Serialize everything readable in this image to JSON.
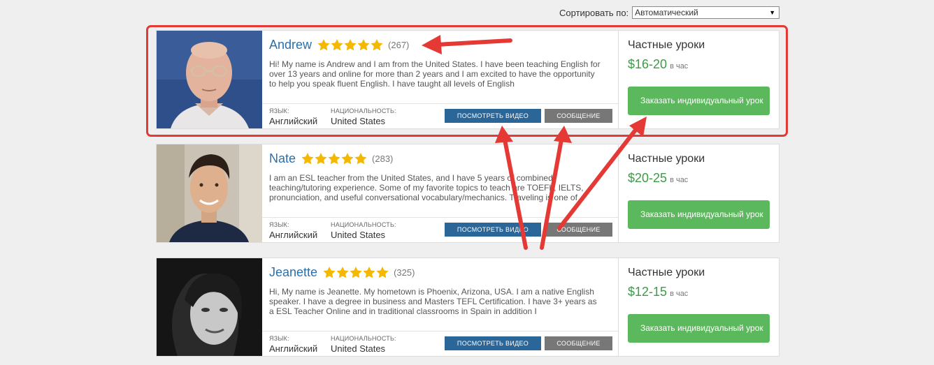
{
  "sort": {
    "label": "Сортировать по:",
    "selected": "Автоматический",
    "arrow_icon": "▼"
  },
  "buttons": {
    "video": "ПОСМОТРЕТЬ ВИДЕО",
    "message": "СООБЩЕНИЕ"
  },
  "labels": {
    "language": "ЯЗЫК:",
    "nationality": "НАЦИОНАЛЬНОСТЬ:",
    "lessons": "Частные уроки",
    "per_hour": "в час",
    "order": "Заказать индивидуальный урок"
  },
  "teachers": [
    {
      "name": "Andrew",
      "rating": 5,
      "reviews": "(267)",
      "bio": "Hi! My name is Andrew and I am from the United States. I have been teaching English for over 13 years and online for more than 2 years and I am excited to have the opportunity to help you speak fluent English. I have taught all levels of English",
      "language": "Английский",
      "nationality": "United States",
      "price": "$16-20"
    },
    {
      "name": "Nate",
      "rating": 5,
      "reviews": "(283)",
      "bio": "I am an ESL teacher from the United States, and I have 5 years of combined teaching/tutoring experience. Some of my favorite topics to teach are TOEFL, IELTS, pronunciation, and useful conversational vocabulary/mechanics. Traveling is one of",
      "language": "Английский",
      "nationality": "United States",
      "price": "$20-25"
    },
    {
      "name": "Jeanette",
      "rating": 5,
      "reviews": "(325)",
      "bio": "Hi, My name is Jeanette. My hometown is Phoenix, Arizona, USA. I am a native English speaker. I have a degree in business and Masters TEFL Certification. I have 3+ years as a ESL Teacher Online and in traditional classrooms in Spain in addition I",
      "language": "Английский",
      "nationality": "United States",
      "price": "$12-15"
    }
  ],
  "colors": {
    "accent_red": "#e53935",
    "name_blue": "#2a6fad",
    "price_green": "#3a9c45",
    "order_green": "#5cb85c",
    "video_blue": "#2b6699",
    "star_gold": "#f5b800"
  }
}
